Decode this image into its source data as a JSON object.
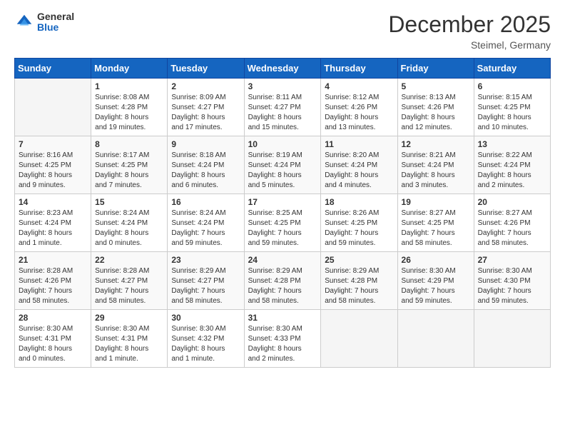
{
  "logo": {
    "general": "General",
    "blue": "Blue"
  },
  "header": {
    "title": "December 2025",
    "location": "Steimel, Germany"
  },
  "days_of_week": [
    "Sunday",
    "Monday",
    "Tuesday",
    "Wednesday",
    "Thursday",
    "Friday",
    "Saturday"
  ],
  "weeks": [
    [
      {
        "day": "",
        "info": ""
      },
      {
        "day": "1",
        "info": "Sunrise: 8:08 AM\nSunset: 4:28 PM\nDaylight: 8 hours\nand 19 minutes."
      },
      {
        "day": "2",
        "info": "Sunrise: 8:09 AM\nSunset: 4:27 PM\nDaylight: 8 hours\nand 17 minutes."
      },
      {
        "day": "3",
        "info": "Sunrise: 8:11 AM\nSunset: 4:27 PM\nDaylight: 8 hours\nand 15 minutes."
      },
      {
        "day": "4",
        "info": "Sunrise: 8:12 AM\nSunset: 4:26 PM\nDaylight: 8 hours\nand 13 minutes."
      },
      {
        "day": "5",
        "info": "Sunrise: 8:13 AM\nSunset: 4:26 PM\nDaylight: 8 hours\nand 12 minutes."
      },
      {
        "day": "6",
        "info": "Sunrise: 8:15 AM\nSunset: 4:25 PM\nDaylight: 8 hours\nand 10 minutes."
      }
    ],
    [
      {
        "day": "7",
        "info": "Sunrise: 8:16 AM\nSunset: 4:25 PM\nDaylight: 8 hours\nand 9 minutes."
      },
      {
        "day": "8",
        "info": "Sunrise: 8:17 AM\nSunset: 4:25 PM\nDaylight: 8 hours\nand 7 minutes."
      },
      {
        "day": "9",
        "info": "Sunrise: 8:18 AM\nSunset: 4:24 PM\nDaylight: 8 hours\nand 6 minutes."
      },
      {
        "day": "10",
        "info": "Sunrise: 8:19 AM\nSunset: 4:24 PM\nDaylight: 8 hours\nand 5 minutes."
      },
      {
        "day": "11",
        "info": "Sunrise: 8:20 AM\nSunset: 4:24 PM\nDaylight: 8 hours\nand 4 minutes."
      },
      {
        "day": "12",
        "info": "Sunrise: 8:21 AM\nSunset: 4:24 PM\nDaylight: 8 hours\nand 3 minutes."
      },
      {
        "day": "13",
        "info": "Sunrise: 8:22 AM\nSunset: 4:24 PM\nDaylight: 8 hours\nand 2 minutes."
      }
    ],
    [
      {
        "day": "14",
        "info": "Sunrise: 8:23 AM\nSunset: 4:24 PM\nDaylight: 8 hours\nand 1 minute."
      },
      {
        "day": "15",
        "info": "Sunrise: 8:24 AM\nSunset: 4:24 PM\nDaylight: 8 hours\nand 0 minutes."
      },
      {
        "day": "16",
        "info": "Sunrise: 8:24 AM\nSunset: 4:24 PM\nDaylight: 7 hours\nand 59 minutes."
      },
      {
        "day": "17",
        "info": "Sunrise: 8:25 AM\nSunset: 4:25 PM\nDaylight: 7 hours\nand 59 minutes."
      },
      {
        "day": "18",
        "info": "Sunrise: 8:26 AM\nSunset: 4:25 PM\nDaylight: 7 hours\nand 59 minutes."
      },
      {
        "day": "19",
        "info": "Sunrise: 8:27 AM\nSunset: 4:25 PM\nDaylight: 7 hours\nand 58 minutes."
      },
      {
        "day": "20",
        "info": "Sunrise: 8:27 AM\nSunset: 4:26 PM\nDaylight: 7 hours\nand 58 minutes."
      }
    ],
    [
      {
        "day": "21",
        "info": "Sunrise: 8:28 AM\nSunset: 4:26 PM\nDaylight: 7 hours\nand 58 minutes."
      },
      {
        "day": "22",
        "info": "Sunrise: 8:28 AM\nSunset: 4:27 PM\nDaylight: 7 hours\nand 58 minutes."
      },
      {
        "day": "23",
        "info": "Sunrise: 8:29 AM\nSunset: 4:27 PM\nDaylight: 7 hours\nand 58 minutes."
      },
      {
        "day": "24",
        "info": "Sunrise: 8:29 AM\nSunset: 4:28 PM\nDaylight: 7 hours\nand 58 minutes."
      },
      {
        "day": "25",
        "info": "Sunrise: 8:29 AM\nSunset: 4:28 PM\nDaylight: 7 hours\nand 58 minutes."
      },
      {
        "day": "26",
        "info": "Sunrise: 8:30 AM\nSunset: 4:29 PM\nDaylight: 7 hours\nand 59 minutes."
      },
      {
        "day": "27",
        "info": "Sunrise: 8:30 AM\nSunset: 4:30 PM\nDaylight: 7 hours\nand 59 minutes."
      }
    ],
    [
      {
        "day": "28",
        "info": "Sunrise: 8:30 AM\nSunset: 4:31 PM\nDaylight: 8 hours\nand 0 minutes."
      },
      {
        "day": "29",
        "info": "Sunrise: 8:30 AM\nSunset: 4:31 PM\nDaylight: 8 hours\nand 1 minute."
      },
      {
        "day": "30",
        "info": "Sunrise: 8:30 AM\nSunset: 4:32 PM\nDaylight: 8 hours\nand 1 minute."
      },
      {
        "day": "31",
        "info": "Sunrise: 8:30 AM\nSunset: 4:33 PM\nDaylight: 8 hours\nand 2 minutes."
      },
      {
        "day": "",
        "info": ""
      },
      {
        "day": "",
        "info": ""
      },
      {
        "day": "",
        "info": ""
      }
    ]
  ]
}
